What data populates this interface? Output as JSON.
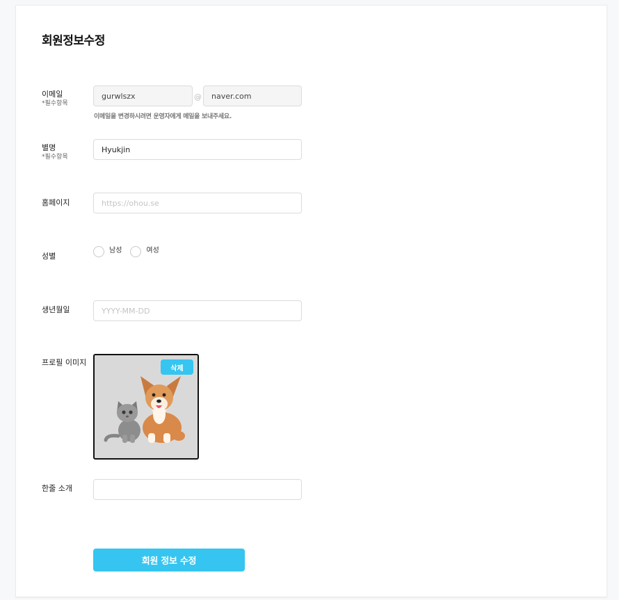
{
  "page": {
    "title": "회원정보수정"
  },
  "email": {
    "label": "이메일",
    "required_note": "*필수항목",
    "local_value": "gurwlszx",
    "at": "@",
    "domain_value": "naver.com",
    "helper": "이메일을 변경하시려면 운영자에게 메일을 보내주세요."
  },
  "nickname": {
    "label": "별명",
    "required_note": "*필수항목",
    "value": "Hyukjin"
  },
  "homepage": {
    "label": "홈페이지",
    "placeholder": "https://ohou.se",
    "value": ""
  },
  "gender": {
    "label": "성별",
    "options": [
      "남성",
      "여성"
    ],
    "selected": null
  },
  "birthdate": {
    "label": "생년월일",
    "placeholder": "YYYY-MM-DD",
    "value": ""
  },
  "profile_image": {
    "label": "프로필 이미지",
    "delete_label": "삭제",
    "image": "cat-and-dog-photo"
  },
  "intro": {
    "label": "한줄 소개",
    "value": ""
  },
  "submit": {
    "label": "회원 정보 수정"
  },
  "colors": {
    "accent": "#35c5f0",
    "image_bg": "#d9d9d9",
    "border": "#dbdbdb"
  }
}
